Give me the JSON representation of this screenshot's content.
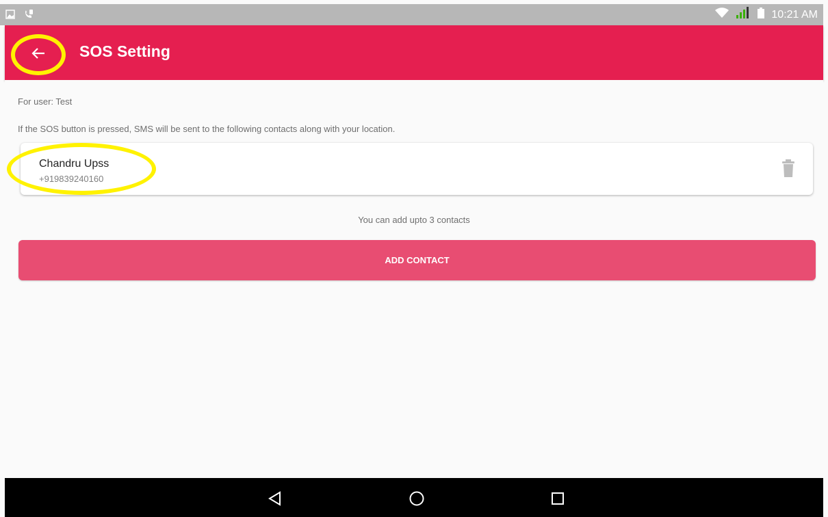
{
  "status_bar": {
    "time": "10:21 AM",
    "icons": [
      "image-icon",
      "call-notification-icon",
      "wifi-icon",
      "signal-icon",
      "battery-icon"
    ]
  },
  "app_bar": {
    "title": "SOS Setting",
    "back_icon": "arrow-left-icon",
    "background_color": "#e51f50"
  },
  "content": {
    "user_label": "For user: Test",
    "info_text": "If the SOS button is pressed, SMS will be sent to the following contacts along with your location.",
    "contacts": [
      {
        "name": "Chandru Upss",
        "phone": "+919839240160"
      }
    ],
    "limit_text": "You can add upto 3 contacts",
    "add_contact_label": "ADD CONTACT",
    "add_button_color": "#e84d72"
  },
  "nav_bar": {
    "buttons": [
      "back-triangle-icon",
      "home-circle-icon",
      "recents-square-icon"
    ]
  },
  "annotations": {
    "highlight_color": "#fff200"
  }
}
